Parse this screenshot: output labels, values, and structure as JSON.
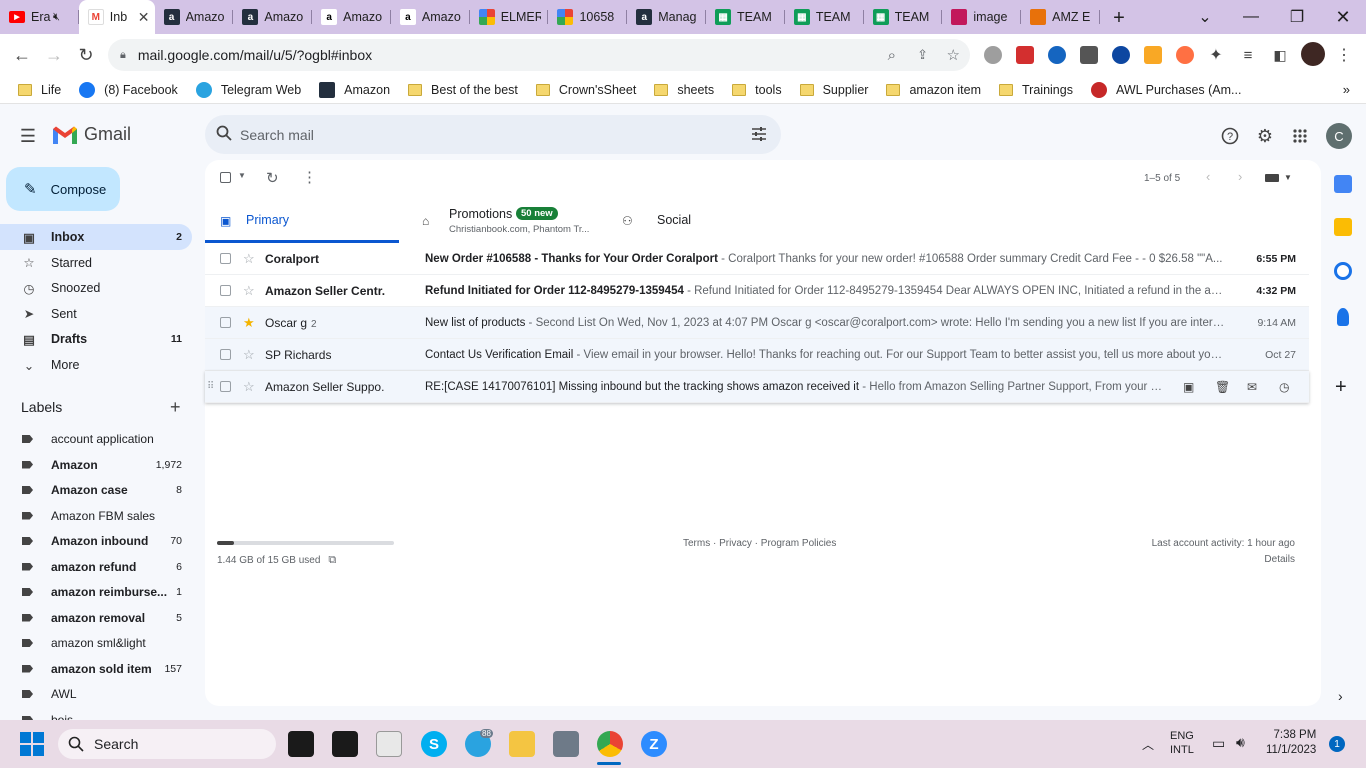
{
  "browser": {
    "tabs": [
      {
        "title": "Era",
        "favicon": "youtube-icon",
        "color": "#ff0000",
        "muted": true
      },
      {
        "title": "Inb",
        "favicon": "gmail-icon",
        "color": "#ffffff",
        "active": true
      },
      {
        "title": "Amazo",
        "favicon": "amazon-icon",
        "color": "#232f3e"
      },
      {
        "title": "Amazo",
        "favicon": "amazon-icon",
        "color": "#232f3e"
      },
      {
        "title": "Amazo",
        "favicon": "amazon-smile-icon",
        "color": "#ffffff"
      },
      {
        "title": "Amazo",
        "favicon": "amazon-smile-icon",
        "color": "#ffffff"
      },
      {
        "title": "ELMER",
        "favicon": "google-apps-icon",
        "color": "#ffffff"
      },
      {
        "title": "10658",
        "favicon": "google-apps-icon",
        "color": "#ffffff"
      },
      {
        "title": "Manag",
        "favicon": "amazon-icon",
        "color": "#232f3e"
      },
      {
        "title": "TEAM",
        "favicon": "sheets-icon",
        "color": "#0f9d58"
      },
      {
        "title": "TEAM",
        "favicon": "sheets-icon",
        "color": "#0f9d58"
      },
      {
        "title": "TEAM",
        "favicon": "sheets-icon",
        "color": "#0f9d58"
      },
      {
        "title": "image",
        "favicon": "image-icon",
        "color": "#c2185b"
      },
      {
        "title": "AMZ E",
        "favicon": "amz-icon",
        "color": "#e8710a"
      }
    ],
    "url": "mail.google.com/mail/u/5/?ogbl#inbox",
    "bookmarks": [
      {
        "label": "Life",
        "icon": "folder-icon"
      },
      {
        "label": "(8) Facebook",
        "icon": "facebook-icon"
      },
      {
        "label": "Telegram Web",
        "icon": "telegram-icon"
      },
      {
        "label": "Amazon",
        "icon": "amazon-icon"
      },
      {
        "label": "Best of the best",
        "icon": "folder-icon"
      },
      {
        "label": "Crown'sSheet",
        "icon": "folder-icon"
      },
      {
        "label": "sheets",
        "icon": "folder-icon"
      },
      {
        "label": "tools",
        "icon": "folder-icon"
      },
      {
        "label": "Supplier",
        "icon": "folder-icon"
      },
      {
        "label": "amazon item",
        "icon": "folder-icon"
      },
      {
        "label": "Trainings",
        "icon": "folder-icon"
      },
      {
        "label": "AWL Purchases (Am...",
        "icon": "awl-icon"
      }
    ]
  },
  "gmail": {
    "brand": "Gmail",
    "search_placeholder": "Search mail",
    "avatar_letter": "C",
    "compose_label": "Compose",
    "nav": [
      {
        "label": "Inbox",
        "count": "2",
        "icon": "inbox-icon",
        "selected": true
      },
      {
        "label": "Starred",
        "count": "",
        "icon": "star-icon"
      },
      {
        "label": "Snoozed",
        "count": "",
        "icon": "clock-icon"
      },
      {
        "label": "Sent",
        "count": "",
        "icon": "send-icon"
      },
      {
        "label": "Drafts",
        "count": "11",
        "icon": "draft-icon",
        "bold": true
      },
      {
        "label": "More",
        "count": "",
        "icon": "chevron-down-icon"
      }
    ],
    "labels_heading": "Labels",
    "labels": [
      {
        "label": "account application",
        "count": "",
        "bold": false
      },
      {
        "label": "Amazon",
        "count": "1,972",
        "bold": true
      },
      {
        "label": "Amazon case",
        "count": "8",
        "bold": true
      },
      {
        "label": "Amazon FBM sales",
        "count": "",
        "bold": false
      },
      {
        "label": "Amazon inbound",
        "count": "70",
        "bold": true
      },
      {
        "label": "amazon refund",
        "count": "6",
        "bold": true
      },
      {
        "label": "amazon reimburse...",
        "count": "1",
        "bold": true
      },
      {
        "label": "amazon removal",
        "count": "5",
        "bold": true
      },
      {
        "label": "amazon sml&light",
        "count": "",
        "bold": false
      },
      {
        "label": "amazon sold item",
        "count": "157",
        "bold": true
      },
      {
        "label": "AWL",
        "count": "",
        "bold": false
      },
      {
        "label": "bois",
        "count": "",
        "bold": false
      }
    ],
    "pagination": "1–5 of 5",
    "tabs": [
      {
        "label": "Primary",
        "sub": "",
        "badge": "",
        "icon": "inbox-tab-icon",
        "active": true
      },
      {
        "label": "Promotions",
        "sub": "Christianbook.com, Phantom Tr...",
        "badge": "50 new",
        "icon": "tag-icon"
      },
      {
        "label": "Social",
        "sub": "",
        "badge": "",
        "icon": "people-icon"
      }
    ],
    "emails": [
      {
        "from": "Coralport",
        "count": "",
        "subject": "New Order #106588 - Thanks for Your Order Coralport",
        "snippet": " - Coralport Thanks for your new order! #106588 Order summary Credit Card Fee - - 0 $26.58 \"\"A...",
        "time": "6:55 PM",
        "unread": true,
        "starred": false
      },
      {
        "from": "Amazon Seller Centr.",
        "count": "",
        "subject": "Refund Initiated for Order 112-8495279-1359454",
        "snippet": " - Refund Initiated for Order 112-8495279-1359454 Dear ALWAYS OPEN INC, Initiated a refund in the am...",
        "time": "4:32 PM",
        "unread": true,
        "starred": false
      },
      {
        "from": "Oscar g",
        "count": "2",
        "subject": "New list of products",
        "snippet": " - Second List On Wed, Nov 1, 2023 at 4:07 PM Oscar g <oscar@coralport.com> wrote: Hello I'm sending you a new list If you are interes...",
        "time": "9:14 AM",
        "unread": false,
        "starred": true
      },
      {
        "from": "SP Richards",
        "count": "",
        "subject": "Contact Us Verification Email",
        "snippet": " - View email in your browser. Hello! Thanks for reaching out. For our Support Team to better assist you, tell us more about your...",
        "time": "Oct 27",
        "unread": false,
        "starred": false
      },
      {
        "from": "Amazon Seller Suppo.",
        "count": "",
        "subject": "RE:[CASE 14170076101] Missing inbound but the tracking shows amazon received it",
        "snippet": " - Hello from Amazon Selling Partner Support, From your mail,...",
        "time": "",
        "unread": false,
        "starred": false,
        "hovered": true
      }
    ],
    "storage": {
      "text": "1.44 GB of 15 GB used",
      "fraction": 0.096
    },
    "footer_links": "Terms · Privacy · Program Policies",
    "last_activity": "Last account activity: 1 hour ago",
    "details": "Details"
  },
  "taskbar": {
    "search_label": "Search",
    "lang": "ENG",
    "lang2": "INTL",
    "time": "7:38 PM",
    "date": "11/1/2023",
    "notifications": "1",
    "telegram_badge": "88"
  }
}
